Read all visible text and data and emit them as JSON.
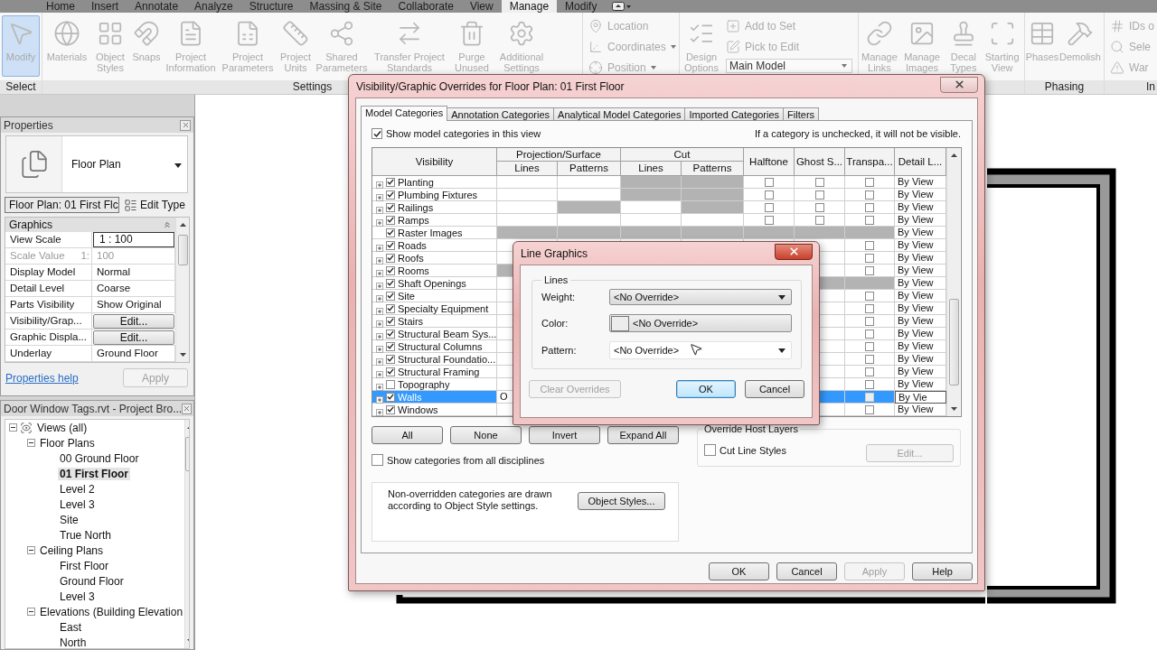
{
  "ribbon": {
    "disabled": true,
    "tabs": [
      {
        "label": "Home",
        "selected": false
      },
      {
        "label": "Insert",
        "selected": false
      },
      {
        "label": "Annotate",
        "selected": false
      },
      {
        "label": "Analyze",
        "selected": false
      },
      {
        "label": "Structure",
        "selected": false
      },
      {
        "label": "Massing & Site",
        "selected": false
      },
      {
        "label": "Collaborate",
        "selected": false
      },
      {
        "label": "View",
        "selected": false
      },
      {
        "label": "Manage",
        "selected": true
      },
      {
        "label": "Modify",
        "selected": false
      }
    ],
    "groups": [
      {
        "label": "Select",
        "items": [
          {
            "kind": "large",
            "label": "Modify",
            "highlighted": true
          }
        ]
      },
      {
        "label": "Settings",
        "items": [
          {
            "kind": "large",
            "label": "Materials",
            "highlighted": false
          },
          {
            "kind": "large",
            "label": "Object Styles",
            "highlighted": false
          },
          {
            "kind": "large",
            "label": "Snaps",
            "highlighted": false
          },
          {
            "kind": "large",
            "label": "Project Information",
            "highlighted": false
          },
          {
            "kind": "large",
            "label": "Project Parameters",
            "highlighted": false
          },
          {
            "kind": "large",
            "label": "Project Units",
            "highlighted": false
          },
          {
            "kind": "large",
            "label": "Shared Parameters",
            "highlighted": false
          },
          {
            "kind": "large",
            "label": "Transfer Project Standards",
            "highlighted": false
          },
          {
            "kind": "large",
            "label": "Purge Unused",
            "highlighted": false
          },
          {
            "kind": "large",
            "label": "Additional Settings",
            "highlighted": false
          }
        ]
      },
      {
        "items": [
          {
            "kind": "stack",
            "items": [
              {
                "kind": "small",
                "label": "Location",
                "dropdown": false
              },
              {
                "kind": "small",
                "label": "Coordinates",
                "dropdown": true
              },
              {
                "kind": "small",
                "label": "Position",
                "dropdown": true
              }
            ]
          }
        ]
      },
      {
        "items": [
          {
            "kind": "large",
            "label": "Design Options",
            "highlighted": false
          },
          {
            "kind": "stack",
            "items": [
              {
                "kind": "small",
                "label": "Add to Set",
                "dropdown": false
              },
              {
                "kind": "small",
                "label": "Pick to Edit",
                "dropdown": false
              },
              {
                "kind": "combo",
                "label": "Main Model"
              }
            ]
          }
        ]
      },
      {
        "items": [
          {
            "kind": "large",
            "label": "Manage Links",
            "highlighted": false
          },
          {
            "kind": "large",
            "label": "Manage Images",
            "highlighted": false
          },
          {
            "kind": "large",
            "label": "Decal Types",
            "highlighted": false
          },
          {
            "kind": "large",
            "label": "Starting View",
            "highlighted": false
          }
        ]
      },
      {
        "label": "Phasing",
        "items": [
          {
            "kind": "large",
            "label": "Phases",
            "highlighted": false
          },
          {
            "kind": "large",
            "label": "Demolish",
            "highlighted": false
          }
        ]
      },
      {
        "label": "In",
        "items": [
          {
            "kind": "stack",
            "items": [
              {
                "kind": "small",
                "label": "IDs o",
                "dropdown": false
              },
              {
                "kind": "small",
                "label": "Sele",
                "dropdown": false
              },
              {
                "kind": "small",
                "label": "War",
                "dropdown": false
              }
            ]
          }
        ]
      }
    ]
  },
  "properties": {
    "title": "Properties",
    "type_name": "Floor Plan",
    "instance": "Floor Plan: 01 First Flc",
    "edit_type": "Edit Type",
    "section": "Graphics",
    "rows": [
      {
        "label": "View Scale",
        "value": "1 : 100",
        "kind": "field"
      },
      {
        "label": "Scale Value",
        "suffix": "1:",
        "value": "100",
        "kind": "readonly"
      },
      {
        "label": "Display Model",
        "value": "Normal",
        "kind": "text"
      },
      {
        "label": "Detail Level",
        "value": "Coarse",
        "kind": "text"
      },
      {
        "label": "Parts Visibility",
        "value": "Show Original",
        "kind": "text"
      },
      {
        "label": "Visibility/Grap...",
        "value": "Edit...",
        "kind": "button"
      },
      {
        "label": "Graphic Displa...",
        "value": "Edit...",
        "kind": "button"
      },
      {
        "label": "Underlay",
        "value": "Ground Floor",
        "kind": "text"
      }
    ],
    "help_link": "Properties help",
    "apply": {
      "label": "Apply",
      "disabled": true
    }
  },
  "browser": {
    "title": "Door Window Tags.rvt - Project Bro...",
    "tree": [
      {
        "label": "Views (all)",
        "expanded": true,
        "selected": false,
        "children": [
          {
            "label": "Floor Plans",
            "expanded": true,
            "selected": false,
            "children": [
              {
                "label": "00 Ground Floor",
                "selected": false
              },
              {
                "label": "01 First Floor",
                "selected": true
              },
              {
                "label": "Level 2",
                "selected": false
              },
              {
                "label": "Level 3",
                "selected": false
              },
              {
                "label": "Site",
                "selected": false
              },
              {
                "label": "True North",
                "selected": false
              }
            ]
          },
          {
            "label": "Ceiling Plans",
            "expanded": true,
            "selected": false,
            "children": [
              {
                "label": "First Floor",
                "selected": false
              },
              {
                "label": "Ground Floor",
                "selected": false
              },
              {
                "label": "Level 3",
                "selected": false
              }
            ]
          },
          {
            "label": "Elevations (Building Elevation",
            "expanded": true,
            "selected": false,
            "children": [
              {
                "label": "East",
                "selected": false
              },
              {
                "label": "North",
                "selected": false
              }
            ]
          }
        ]
      }
    ]
  },
  "vg_dialog": {
    "title": "Visibility/Graphic Overrides for Floor Plan: 01 First Floor",
    "tabs": [
      {
        "label": "Model Categories",
        "selected": true
      },
      {
        "label": "Annotation Categories",
        "selected": false
      },
      {
        "label": "Analytical Model Categories",
        "selected": false
      },
      {
        "label": "Imported Categories",
        "selected": false
      },
      {
        "label": "Filters",
        "selected": false
      }
    ],
    "show_model": {
      "label": "Show model categories in this view",
      "checked": true
    },
    "note": "If a category is unchecked, it will not be visible.",
    "headers": {
      "visibility": "Visibility",
      "projection_surface": "Projection/Surface",
      "projection_lines": "Lines",
      "projection_patterns": "Patterns",
      "cut": "Cut",
      "cut_lines": "Lines",
      "cut_patterns": "Patterns",
      "halftone": "Halftone",
      "ghost": "Ghost S...",
      "transparent": "Transpa...",
      "detail": "Detail L..."
    },
    "rows": [
      {
        "name": "Planting",
        "checked": true,
        "expandable": true,
        "selected": false,
        "disabled": {
          "cut_lines": true,
          "cut_patterns": true
        },
        "halftone": false,
        "ghost": false,
        "transparent": false,
        "detail": "By View"
      },
      {
        "name": "Plumbing Fixtures",
        "checked": true,
        "expandable": true,
        "selected": false,
        "disabled": {
          "cut_lines": true,
          "cut_patterns": true
        },
        "halftone": false,
        "ghost": false,
        "transparent": false,
        "detail": "By View"
      },
      {
        "name": "Railings",
        "checked": true,
        "expandable": true,
        "selected": false,
        "disabled": {
          "projection_patterns": true,
          "cut_patterns": true
        },
        "halftone": false,
        "ghost": false,
        "transparent": false,
        "detail": "By View"
      },
      {
        "name": "Ramps",
        "checked": true,
        "expandable": true,
        "selected": false,
        "disabled": [],
        "halftone": false,
        "ghost": false,
        "transparent": false,
        "detail": "By View"
      },
      {
        "name": "Raster Images",
        "checked": true,
        "expandable": false,
        "selected": false,
        "disabled": {
          "projection_lines": true,
          "projection_patterns": true,
          "cut_lines": true,
          "cut_patterns": true,
          "halftone": true,
          "ghost": true,
          "transparent": true
        },
        "detail": "By View"
      },
      {
        "name": "Roads",
        "checked": true,
        "expandable": true,
        "selected": false,
        "disabled": [],
        "transparent": false,
        "detail": "By View"
      },
      {
        "name": "Roofs",
        "checked": true,
        "expandable": true,
        "selected": false,
        "disabled": [],
        "transparent": false,
        "detail": "By View"
      },
      {
        "name": "Rooms",
        "checked": true,
        "expandable": true,
        "selected": false,
        "disabled": {
          "projection_lines": true
        },
        "transparent": false,
        "detail": "By View"
      },
      {
        "name": "Shaft Openings",
        "checked": true,
        "expandable": true,
        "selected": false,
        "disabled": {
          "ghost": true,
          "transparent": true
        },
        "detail": "By View"
      },
      {
        "name": "Site",
        "checked": true,
        "expandable": true,
        "selected": false,
        "disabled": [],
        "transparent": false,
        "detail": "By View"
      },
      {
        "name": "Specialty Equipment",
        "checked": true,
        "expandable": true,
        "selected": false,
        "disabled": [],
        "transparent": false,
        "detail": "By View"
      },
      {
        "name": "Stairs",
        "checked": true,
        "expandable": true,
        "selected": false,
        "disabled": [],
        "transparent": false,
        "detail": "By View"
      },
      {
        "name": "Structural Beam Sys...",
        "checked": true,
        "expandable": true,
        "selected": false,
        "disabled": [],
        "transparent": false,
        "detail": "By View"
      },
      {
        "name": "Structural Columns",
        "checked": true,
        "expandable": true,
        "selected": false,
        "disabled": [],
        "transparent": false,
        "detail": "By View"
      },
      {
        "name": "Structural Foundatio...",
        "checked": true,
        "expandable": true,
        "selected": false,
        "disabled": [],
        "transparent": false,
        "detail": "By View"
      },
      {
        "name": "Structural Framing",
        "checked": true,
        "expandable": true,
        "selected": false,
        "disabled": [],
        "transparent": false,
        "detail": "By View"
      },
      {
        "name": "Topography",
        "checked": false,
        "expandable": true,
        "selected": false,
        "disabled": [],
        "transparent": false,
        "detail": "By View"
      },
      {
        "name": "Walls",
        "checked": true,
        "expandable": true,
        "selected": true,
        "disabled": [],
        "projection_lines": "O",
        "transparent": false,
        "detail": "By Vie"
      },
      {
        "name": "Windows",
        "checked": true,
        "expandable": true,
        "selected": false,
        "disabled": [],
        "transparent": false,
        "detail": "By View"
      }
    ],
    "buttons": [
      "All",
      "None",
      "Invert",
      "Expand All"
    ],
    "show_all": {
      "label": "Show categories from all disciplines",
      "checked": false
    },
    "host_layers": {
      "title": "Override Host Layers",
      "cut_line_styles": {
        "label": "Cut Line Styles",
        "checked": false
      },
      "edit": {
        "label": "Edit...",
        "disabled": true
      }
    },
    "info": "Non-overridden categories are drawn according to Object Style settings.",
    "object_styles": "Object Styles...",
    "footer": [
      {
        "label": "OK",
        "disabled": false
      },
      {
        "label": "Cancel",
        "disabled": false
      },
      {
        "label": "Apply",
        "disabled": true
      },
      {
        "label": "Help",
        "disabled": false
      }
    ]
  },
  "line_dialog": {
    "title": "Line Graphics",
    "group": "Lines",
    "fields": [
      {
        "label": "Weight:",
        "value": "<No Override>",
        "kind": "select"
      },
      {
        "label": "Color:",
        "value": "<No Override>",
        "kind": "color"
      },
      {
        "label": "Pattern:",
        "value": "<No Override>",
        "kind": "combo"
      }
    ],
    "buttons": [
      {
        "label": "Clear Overrides",
        "disabled": true,
        "default": false
      },
      {
        "label": "OK",
        "disabled": false,
        "default": true
      },
      {
        "label": "Cancel",
        "disabled": false,
        "default": false
      }
    ]
  }
}
